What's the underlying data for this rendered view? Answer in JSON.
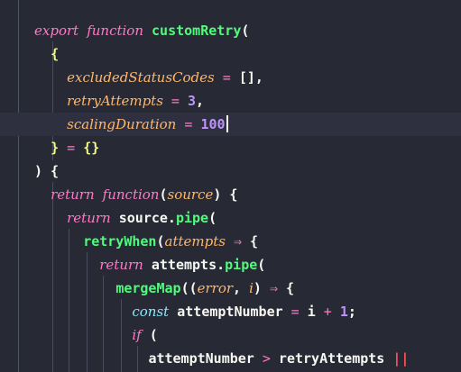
{
  "theme_colors": {
    "background": "#272935",
    "keyword": "#ff79c6",
    "function": "#50fa7b",
    "parameter": "#ffb86c",
    "number": "#bd93f9",
    "text": "#f8f8f2"
  },
  "lines": [
    {
      "tokens": [
        {
          "t": "export",
          "c": "kw"
        },
        {
          "t": " ",
          "c": "punc"
        },
        {
          "t": "function",
          "c": "kw"
        },
        {
          "t": " ",
          "c": "punc"
        },
        {
          "t": "customRetry",
          "c": "fn"
        },
        {
          "t": "(",
          "c": "punc"
        }
      ]
    },
    {
      "tokens": [
        {
          "t": "  ",
          "c": "punc"
        },
        {
          "t": "{",
          "c": "bracket-y"
        }
      ]
    },
    {
      "tokens": [
        {
          "t": "    ",
          "c": "punc"
        },
        {
          "t": "excludedStatusCodes",
          "c": "param"
        },
        {
          "t": " = ",
          "c": "op"
        },
        {
          "t": "[]",
          "c": "punc"
        },
        {
          "t": ",",
          "c": "punc"
        }
      ]
    },
    {
      "tokens": [
        {
          "t": "    ",
          "c": "punc"
        },
        {
          "t": "retryAttempts",
          "c": "param"
        },
        {
          "t": " = ",
          "c": "op"
        },
        {
          "t": "3",
          "c": "num"
        },
        {
          "t": ",",
          "c": "punc"
        }
      ]
    },
    {
      "tokens": [
        {
          "t": "    ",
          "c": "punc"
        },
        {
          "t": "scalingDuration",
          "c": "param"
        },
        {
          "t": " = ",
          "c": "op"
        },
        {
          "t": "100",
          "c": "num"
        }
      ],
      "active": true,
      "cursor": true
    },
    {
      "tokens": [
        {
          "t": "  ",
          "c": "punc"
        },
        {
          "t": "}",
          "c": "bracket-y"
        },
        {
          "t": " = ",
          "c": "op"
        },
        {
          "t": "{}",
          "c": "bracket-y"
        }
      ]
    },
    {
      "tokens": [
        {
          "t": ") {",
          "c": "punc"
        }
      ]
    },
    {
      "tokens": [
        {
          "t": "  ",
          "c": "punc"
        },
        {
          "t": "return",
          "c": "kw"
        },
        {
          "t": " ",
          "c": "punc"
        },
        {
          "t": "function",
          "c": "kw"
        },
        {
          "t": "(",
          "c": "punc"
        },
        {
          "t": "source",
          "c": "param"
        },
        {
          "t": ") {",
          "c": "punc"
        }
      ]
    },
    {
      "tokens": [
        {
          "t": "    ",
          "c": "punc"
        },
        {
          "t": "return",
          "c": "kw"
        },
        {
          "t": " source.",
          "c": "var"
        },
        {
          "t": "pipe",
          "c": "fn"
        },
        {
          "t": "(",
          "c": "punc"
        }
      ]
    },
    {
      "tokens": [
        {
          "t": "      ",
          "c": "punc"
        },
        {
          "t": "retryWhen",
          "c": "fn"
        },
        {
          "t": "(",
          "c": "punc"
        },
        {
          "t": "attempts",
          "c": "param"
        },
        {
          "t": " ⇒ ",
          "c": "op"
        },
        {
          "t": "{",
          "c": "punc"
        }
      ]
    },
    {
      "tokens": [
        {
          "t": "        ",
          "c": "punc"
        },
        {
          "t": "return",
          "c": "kw"
        },
        {
          "t": " attempts.",
          "c": "var"
        },
        {
          "t": "pipe",
          "c": "fn"
        },
        {
          "t": "(",
          "c": "punc"
        }
      ]
    },
    {
      "tokens": [
        {
          "t": "          ",
          "c": "punc"
        },
        {
          "t": "mergeMap",
          "c": "fn"
        },
        {
          "t": "((",
          "c": "punc"
        },
        {
          "t": "error",
          "c": "param"
        },
        {
          "t": ", ",
          "c": "punc"
        },
        {
          "t": "i",
          "c": "param"
        },
        {
          "t": ") ",
          "c": "punc"
        },
        {
          "t": "⇒",
          "c": "op"
        },
        {
          "t": " {",
          "c": "punc"
        }
      ]
    },
    {
      "tokens": [
        {
          "t": "            ",
          "c": "punc"
        },
        {
          "t": "const",
          "c": "kw-const"
        },
        {
          "t": " attemptNumber ",
          "c": "var"
        },
        {
          "t": "=",
          "c": "op"
        },
        {
          "t": " i ",
          "c": "var"
        },
        {
          "t": "+",
          "c": "op"
        },
        {
          "t": " ",
          "c": "punc"
        },
        {
          "t": "1",
          "c": "num"
        },
        {
          "t": ";",
          "c": "punc"
        }
      ]
    },
    {
      "tokens": [
        {
          "t": "            ",
          "c": "punc"
        },
        {
          "t": "if",
          "c": "kw"
        },
        {
          "t": " (",
          "c": "punc"
        }
      ]
    },
    {
      "tokens": [
        {
          "t": "              ",
          "c": "punc"
        },
        {
          "t": "attemptNumber ",
          "c": "var"
        },
        {
          "t": ">",
          "c": "op"
        },
        {
          "t": " retryAttempts ",
          "c": "var"
        },
        {
          "t": "||",
          "c": "comment"
        }
      ]
    }
  ]
}
